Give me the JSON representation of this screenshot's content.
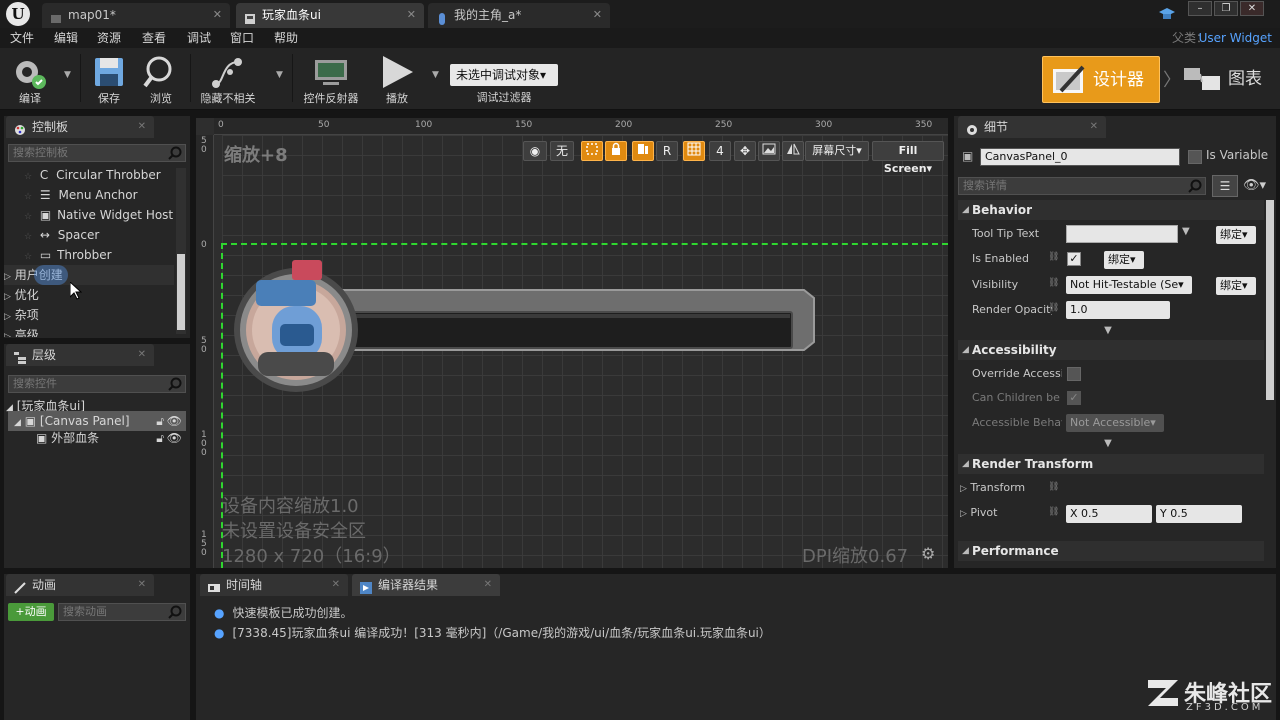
{
  "titlebar": {
    "tabs": [
      {
        "label": "map01*"
      },
      {
        "label": "玩家血条ui"
      },
      {
        "label": "我的主角_a*"
      }
    ],
    "window_buttons": [
      "–",
      "❐",
      "✕"
    ]
  },
  "menu": {
    "items": [
      "文件",
      "编辑",
      "资源",
      "查看",
      "调试",
      "窗口",
      "帮助"
    ],
    "parent_label": "父类：",
    "parent_value": "User Widget"
  },
  "toolbar": {
    "compile": "编译",
    "save": "保存",
    "browse": "浏览",
    "hide_unrelated": "隐藏不相关",
    "widget_reflector": "控件反射器",
    "play": "播放",
    "debug_object": "未选中调试对象▾",
    "debug_filter": "调试过滤器",
    "designer": "设计器",
    "graph": "图表"
  },
  "palette": {
    "tab": "控制板",
    "search_placeholder": "搜索控制板",
    "items": [
      "Circular Throbber",
      "Menu Anchor",
      "Native Widget Host",
      "Spacer",
      "Throbber"
    ],
    "categories": [
      "用户创建",
      "优化",
      "杂项",
      "高级"
    ]
  },
  "hierarchy": {
    "tab": "层级",
    "search_placeholder": "搜索控件",
    "root": "[玩家血条ui]",
    "canvas": "[Canvas Panel]",
    "child": "外部血条"
  },
  "animation": {
    "tab": "动画",
    "add_button": "+动画",
    "search_placeholder": "搜索动画"
  },
  "viewport": {
    "zoom": "缩放+8",
    "ruler_top": [
      "0",
      "50",
      "100",
      "150",
      "200",
      "250",
      "300",
      "350"
    ],
    "ruler_left": [
      "5\n0",
      "0",
      "5\n0",
      "1\n0\n0",
      "1\n5\n0"
    ],
    "controls": {
      "globe": "◉",
      "none": "无",
      "r": "R",
      "four": "4",
      "screen_size": "屏幕尺寸▾",
      "fill_screen": "Fill Screen▾"
    },
    "device_scale": "设备内容缩放1.0",
    "safe_zone": "未设置设备安全区",
    "resolution": "1280 x 720（16:9）",
    "dpi": "DPI缩放0.67"
  },
  "details": {
    "tab": "细节",
    "name": "CanvasPanel_0",
    "is_variable": "Is Variable",
    "search_placeholder": "搜索详情",
    "sections": {
      "behavior": "Behavior",
      "accessibility": "Accessibility",
      "render_transform": "Render Transform",
      "performance": "Performance"
    },
    "props": {
      "tooltip": "Tool Tip Text",
      "is_enabled": "Is Enabled",
      "visibility": "Visibility",
      "visibility_value": "Not Hit-Testable (Se▾",
      "render_opacity": "Render Opacity",
      "render_opacity_value": "1.0",
      "override_accessible": "Override Accessit",
      "can_children": "Can Children be A",
      "accessible_behavior": "Accessible Behav",
      "accessible_behavior_value": "Not Accessible▾",
      "transform": "Transform",
      "pivot": "Pivot",
      "pivot_x": "X  0.5",
      "pivot_y": "Y  0.5",
      "bind": "绑定▾"
    }
  },
  "bottom": {
    "timeline_tab": "时间轴",
    "compiler_tab": "编译器结果",
    "log": [
      "快速模板已成功创建。",
      "[7338.45]玩家血条ui 编译成功！[313 毫秒内]（/Game/我的游戏/ui/血条/玩家血条ui.玩家血条ui）"
    ]
  },
  "watermark": {
    "name": "朱峰社区",
    "url": "ZF3D.COM"
  }
}
